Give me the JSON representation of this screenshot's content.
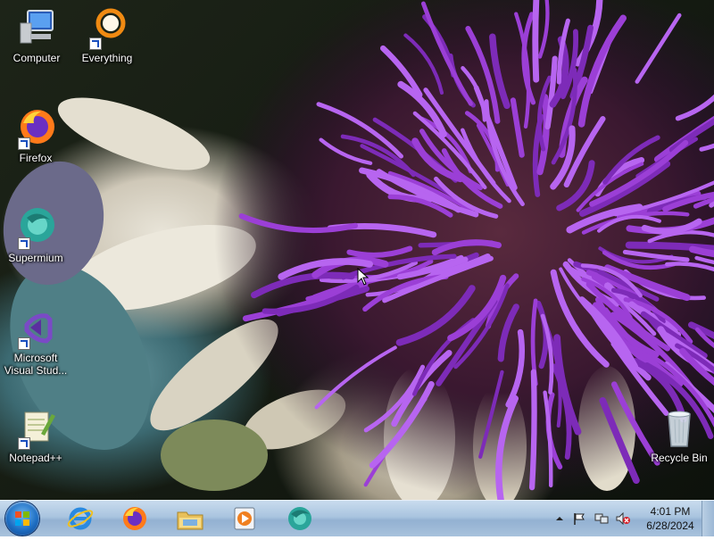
{
  "desktop": {
    "icons": [
      {
        "label": "Computer"
      },
      {
        "label": "Everything"
      },
      {
        "label": "Firefox"
      },
      {
        "label": "Supermium"
      },
      {
        "label": "Microsoft Visual Stud..."
      },
      {
        "label": "Notepad++"
      },
      {
        "label": "Recycle Bin"
      }
    ]
  },
  "taskbar": {
    "pinned": [
      {
        "icon": "internet-explorer-icon"
      },
      {
        "icon": "firefox-icon"
      },
      {
        "icon": "file-explorer-icon"
      },
      {
        "icon": "media-player-icon"
      },
      {
        "icon": "supermium-icon"
      }
    ],
    "tray": {
      "icons": [
        "show-hidden-icons-arrow",
        "action-center-flag-icon",
        "network-icon",
        "volume-muted-icon"
      ]
    },
    "clock": {
      "time": "4:01 PM",
      "date": "6/28/2024"
    }
  },
  "colors": {
    "taskbar": "#a9c4df",
    "wallpaper_purple": "#9b3fd6",
    "label_text": "#ffffff"
  }
}
